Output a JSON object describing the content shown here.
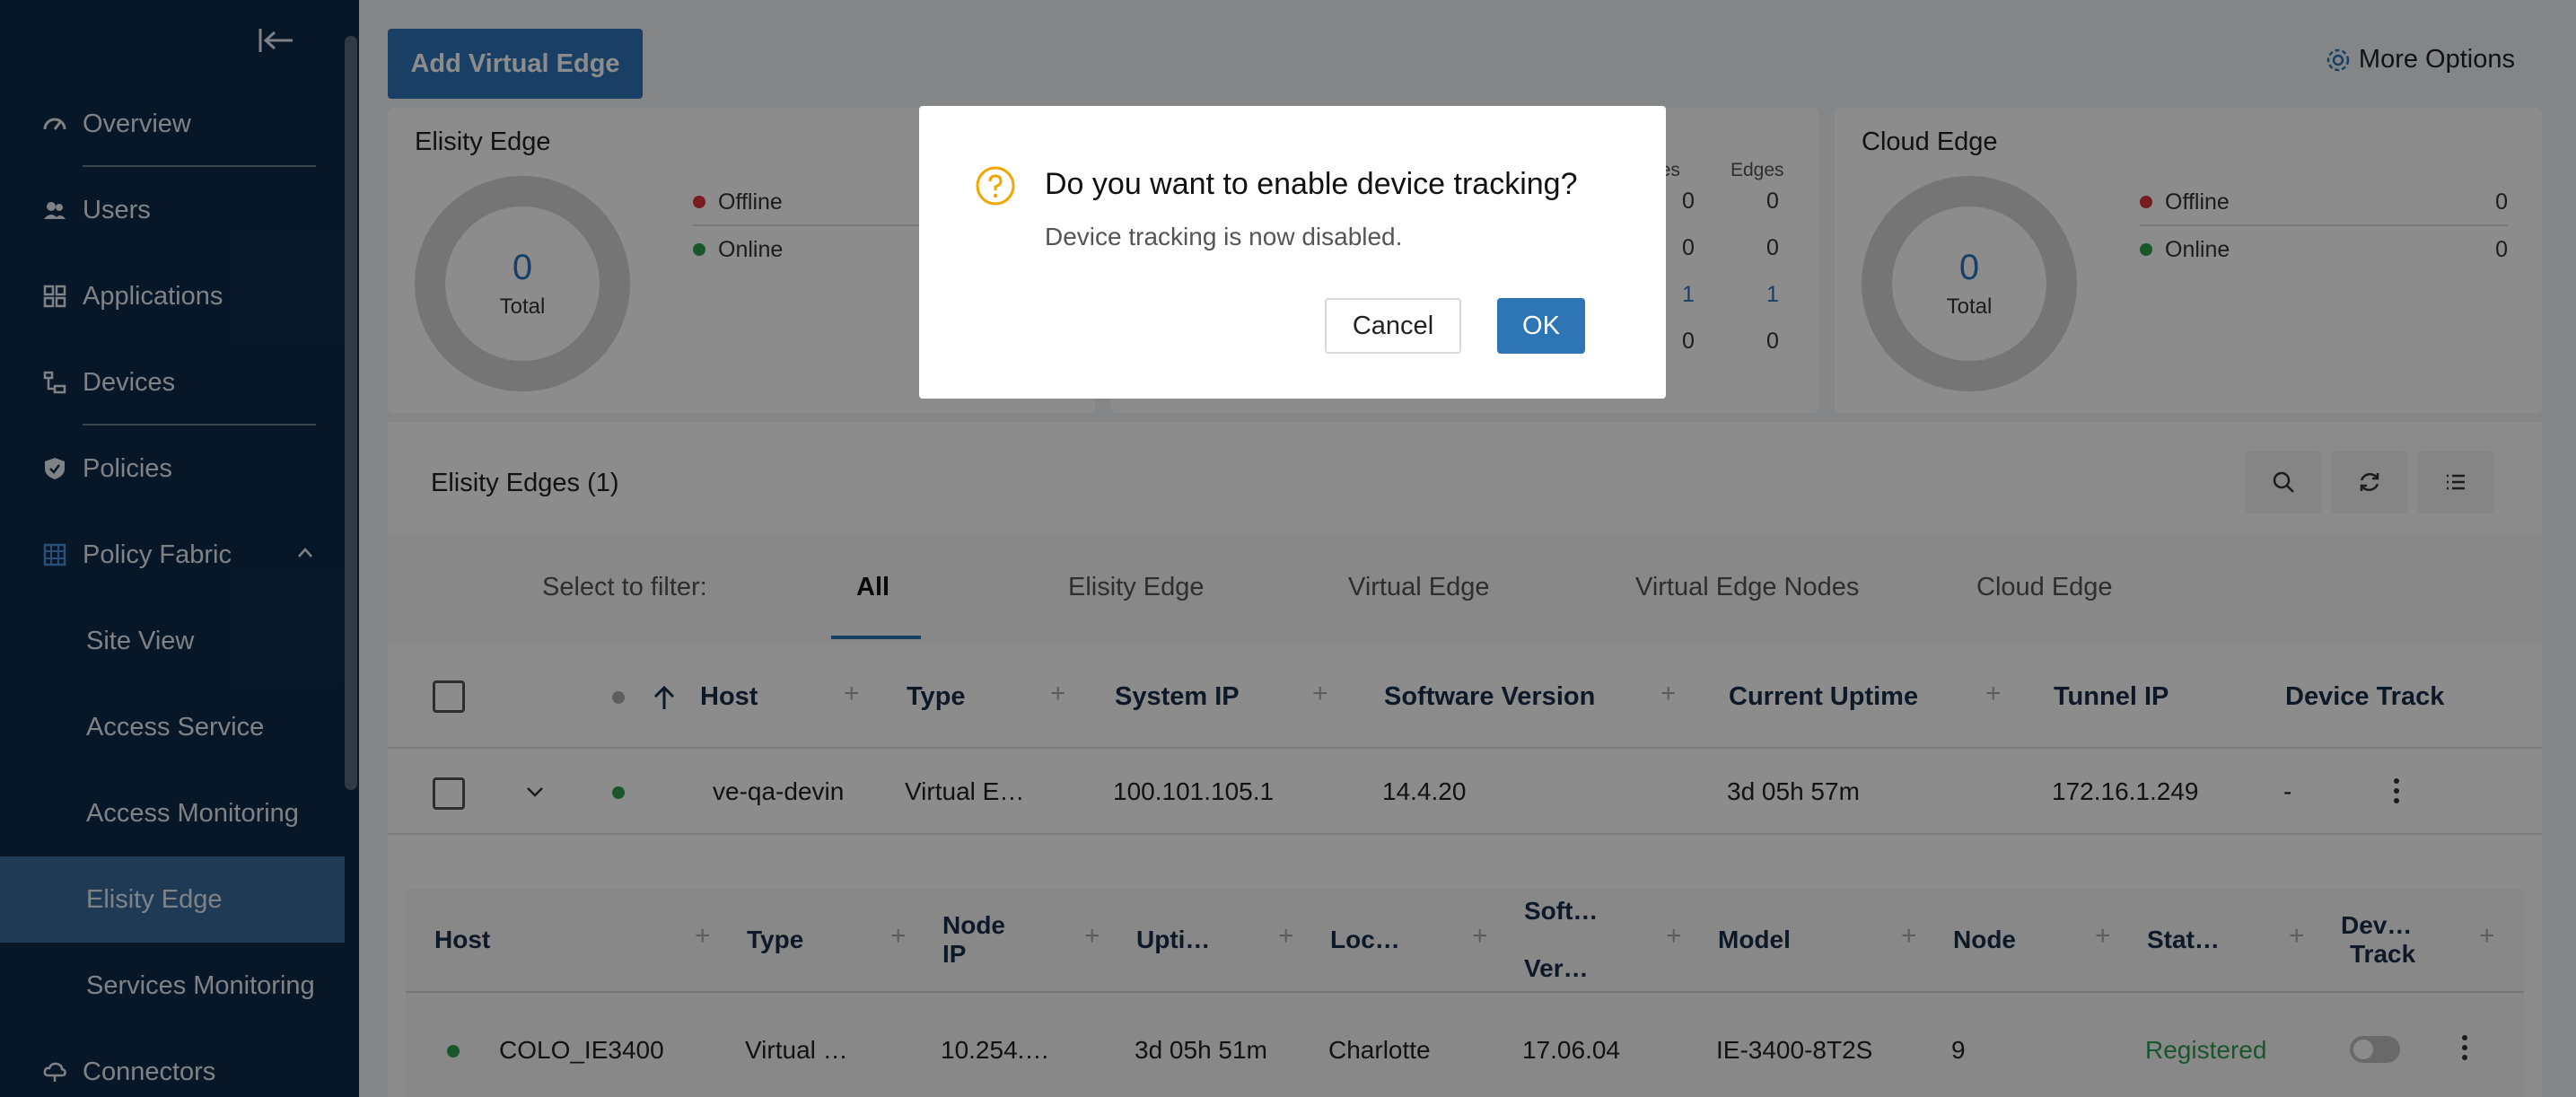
{
  "sidebar": {
    "items": [
      {
        "label": "Overview",
        "icon": "dashboard-icon"
      },
      {
        "label": "Users",
        "icon": "users-icon"
      },
      {
        "label": "Applications",
        "icon": "grid-icon"
      },
      {
        "label": "Devices",
        "icon": "devices-icon"
      },
      {
        "label": "Policies",
        "icon": "shield-icon"
      },
      {
        "label": "Policy Fabric",
        "icon": "fabric-icon"
      },
      {
        "label": "Site View"
      },
      {
        "label": "Access Service"
      },
      {
        "label": "Access Monitoring"
      },
      {
        "label": "Elisity Edge"
      },
      {
        "label": "Services Monitoring"
      },
      {
        "label": "Connectors",
        "icon": "cloud-icon"
      }
    ]
  },
  "toolbar": {
    "add_label": "Add Virtual Edge",
    "more_options_label": "More Options"
  },
  "cards": {
    "elisity": {
      "title": "Elisity Edge",
      "total": "0",
      "total_label": "Total",
      "offline_label": "Offline",
      "online_label": "Online"
    },
    "virtual": {
      "col_nodes": "des",
      "col_edges": "Edges",
      "rows": [
        [
          "0",
          "0"
        ],
        [
          "0",
          "0"
        ],
        [
          "1",
          "1"
        ],
        [
          "0",
          "0"
        ]
      ]
    },
    "cloud": {
      "title": "Cloud Edge",
      "total": "0",
      "total_label": "Total",
      "offline_label": "Offline",
      "offline_value": "0",
      "online_label": "Online",
      "online_value": "0"
    }
  },
  "table": {
    "title": "Elisity Edges (1)",
    "filter_label": "Select to filter:",
    "filters": [
      "All",
      "Elisity Edge",
      "Virtual Edge",
      "Virtual Edge Nodes",
      "Cloud Edge"
    ],
    "headers": [
      "Host",
      "Type",
      "System IP",
      "Software Version",
      "Current Uptime",
      "Tunnel IP",
      "Device Track"
    ],
    "row": {
      "host": "ve-qa-devin",
      "type": "Virtual E…",
      "system_ip": "100.101.105.1",
      "software_version": "14.4.20",
      "uptime": "3d 05h 57m",
      "tunnel_ip": "172.16.1.249",
      "device_track": "-"
    }
  },
  "sub_table": {
    "headers": {
      "host": "Host",
      "type": "Type",
      "node_ip_1": "Node",
      "node_ip_2": "IP",
      "uptime": "Upti…",
      "location": "Loc…",
      "soft_1": "Soft…",
      "soft_2": "Ver…",
      "model": "Model",
      "node": "Node",
      "status": "Stat…",
      "dev_1": "Dev…",
      "dev_2": "Track"
    },
    "row": {
      "host": "COLO_IE3400",
      "type": "Virtual …",
      "node_ip": "10.254.…",
      "uptime": "3d 05h 51m",
      "location": "Charlotte",
      "software": "17.06.04",
      "model": "IE-3400-8T2S",
      "node": "9",
      "status": "Registered"
    }
  },
  "modal": {
    "title": "Do you want to enable device tracking?",
    "body": "Device tracking is now disabled.",
    "cancel_label": "Cancel",
    "ok_label": "OK"
  },
  "colors": {
    "sidebar_bg": "#0f2a4a",
    "accent": "#2e75b6",
    "offline": "#d9363e",
    "online": "#2e9e4e",
    "warning": "#f0a500"
  }
}
